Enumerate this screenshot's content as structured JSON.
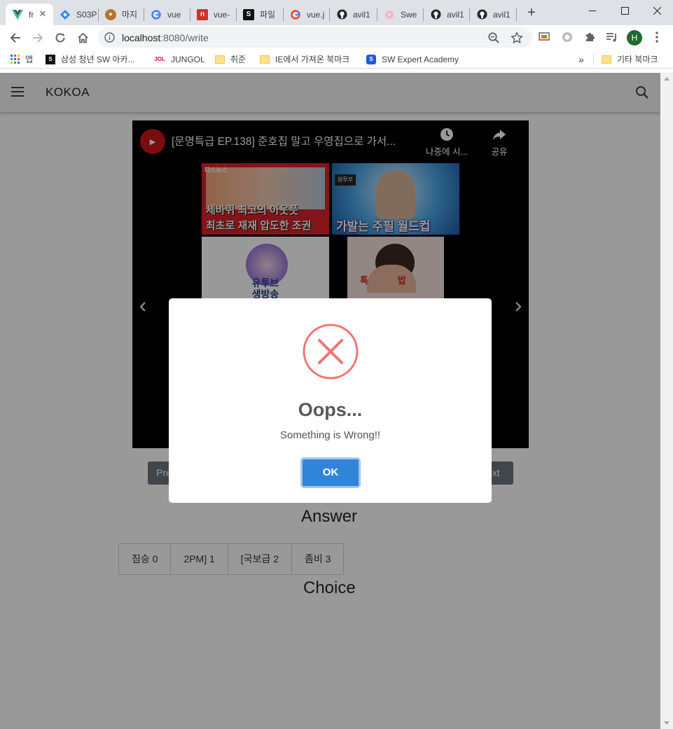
{
  "browser": {
    "tabs": [
      {
        "title": "fr",
        "favicon": "vue-icon"
      },
      {
        "title": "S03P",
        "favicon": "jira-icon"
      },
      {
        "title": "마지",
        "favicon": "monkey-icon"
      },
      {
        "title": "vue",
        "favicon": "google-icon"
      },
      {
        "title": "vue-",
        "favicon": "n-icon"
      },
      {
        "title": "파일",
        "favicon": "samsung-icon"
      },
      {
        "title": "vue.j",
        "favicon": "google-icon"
      },
      {
        "title": "avil1",
        "favicon": "github-icon"
      },
      {
        "title": "Swe",
        "favicon": "donut-icon"
      },
      {
        "title": "avil1",
        "favicon": "github-icon"
      },
      {
        "title": "avil1",
        "favicon": "github-icon"
      }
    ],
    "new_tab": "+",
    "url_host": "localhost",
    "url_path": ":8080/write",
    "profile_initial": "H",
    "bookmarks": [
      {
        "label": "앱",
        "icon": "apps-grid-icon"
      },
      {
        "label": "삼성 청년 SW 아카...",
        "icon": "samsung-icon"
      },
      {
        "label": "JUNGOL",
        "icon": "jol-icon"
      },
      {
        "label": "취준",
        "icon": "folder-icon"
      },
      {
        "label": "IE에서 가져온 북마크",
        "icon": "folder-icon"
      },
      {
        "label": "SW Expert Academy",
        "icon": "swea-icon"
      }
    ],
    "bookmarks_overflow": "»",
    "other_bookmarks": "기타 북마크"
  },
  "app": {
    "brand": "KOKOA",
    "video": {
      "title": "[문명특급 EP.138] 준호집 말고 우영집으로 가서...",
      "watch_later": "나중에 시...",
      "share": "공유",
      "thumbnails": [
        {
          "caption_1": "세바퀴 최고의 아웃풋",
          "caption_2": "최초로 재재 압도한 조권",
          "corner": "다스뉴스"
        },
        {
          "caption_1": "가발는 주필 월드컵",
          "corner": "원투부"
        },
        {
          "caption_1": "유투브",
          "caption_2": "생방송"
        },
        {
          "caption_1": "톡",
          "caption_2": "밥"
        }
      ]
    },
    "prev_label": "Pre",
    "next_label": "ext",
    "answer_heading": "Answer",
    "choices": [
      "짐승 0",
      "2PM] 1",
      "[국보급 2",
      "좀비 3"
    ],
    "choice_heading": "Choice"
  },
  "modal": {
    "title": "Oops...",
    "text": "Something is Wrong!!",
    "ok_label": "OK",
    "icon": "error-x-icon",
    "error_color": "#f27474",
    "button_color": "#3085d6"
  }
}
